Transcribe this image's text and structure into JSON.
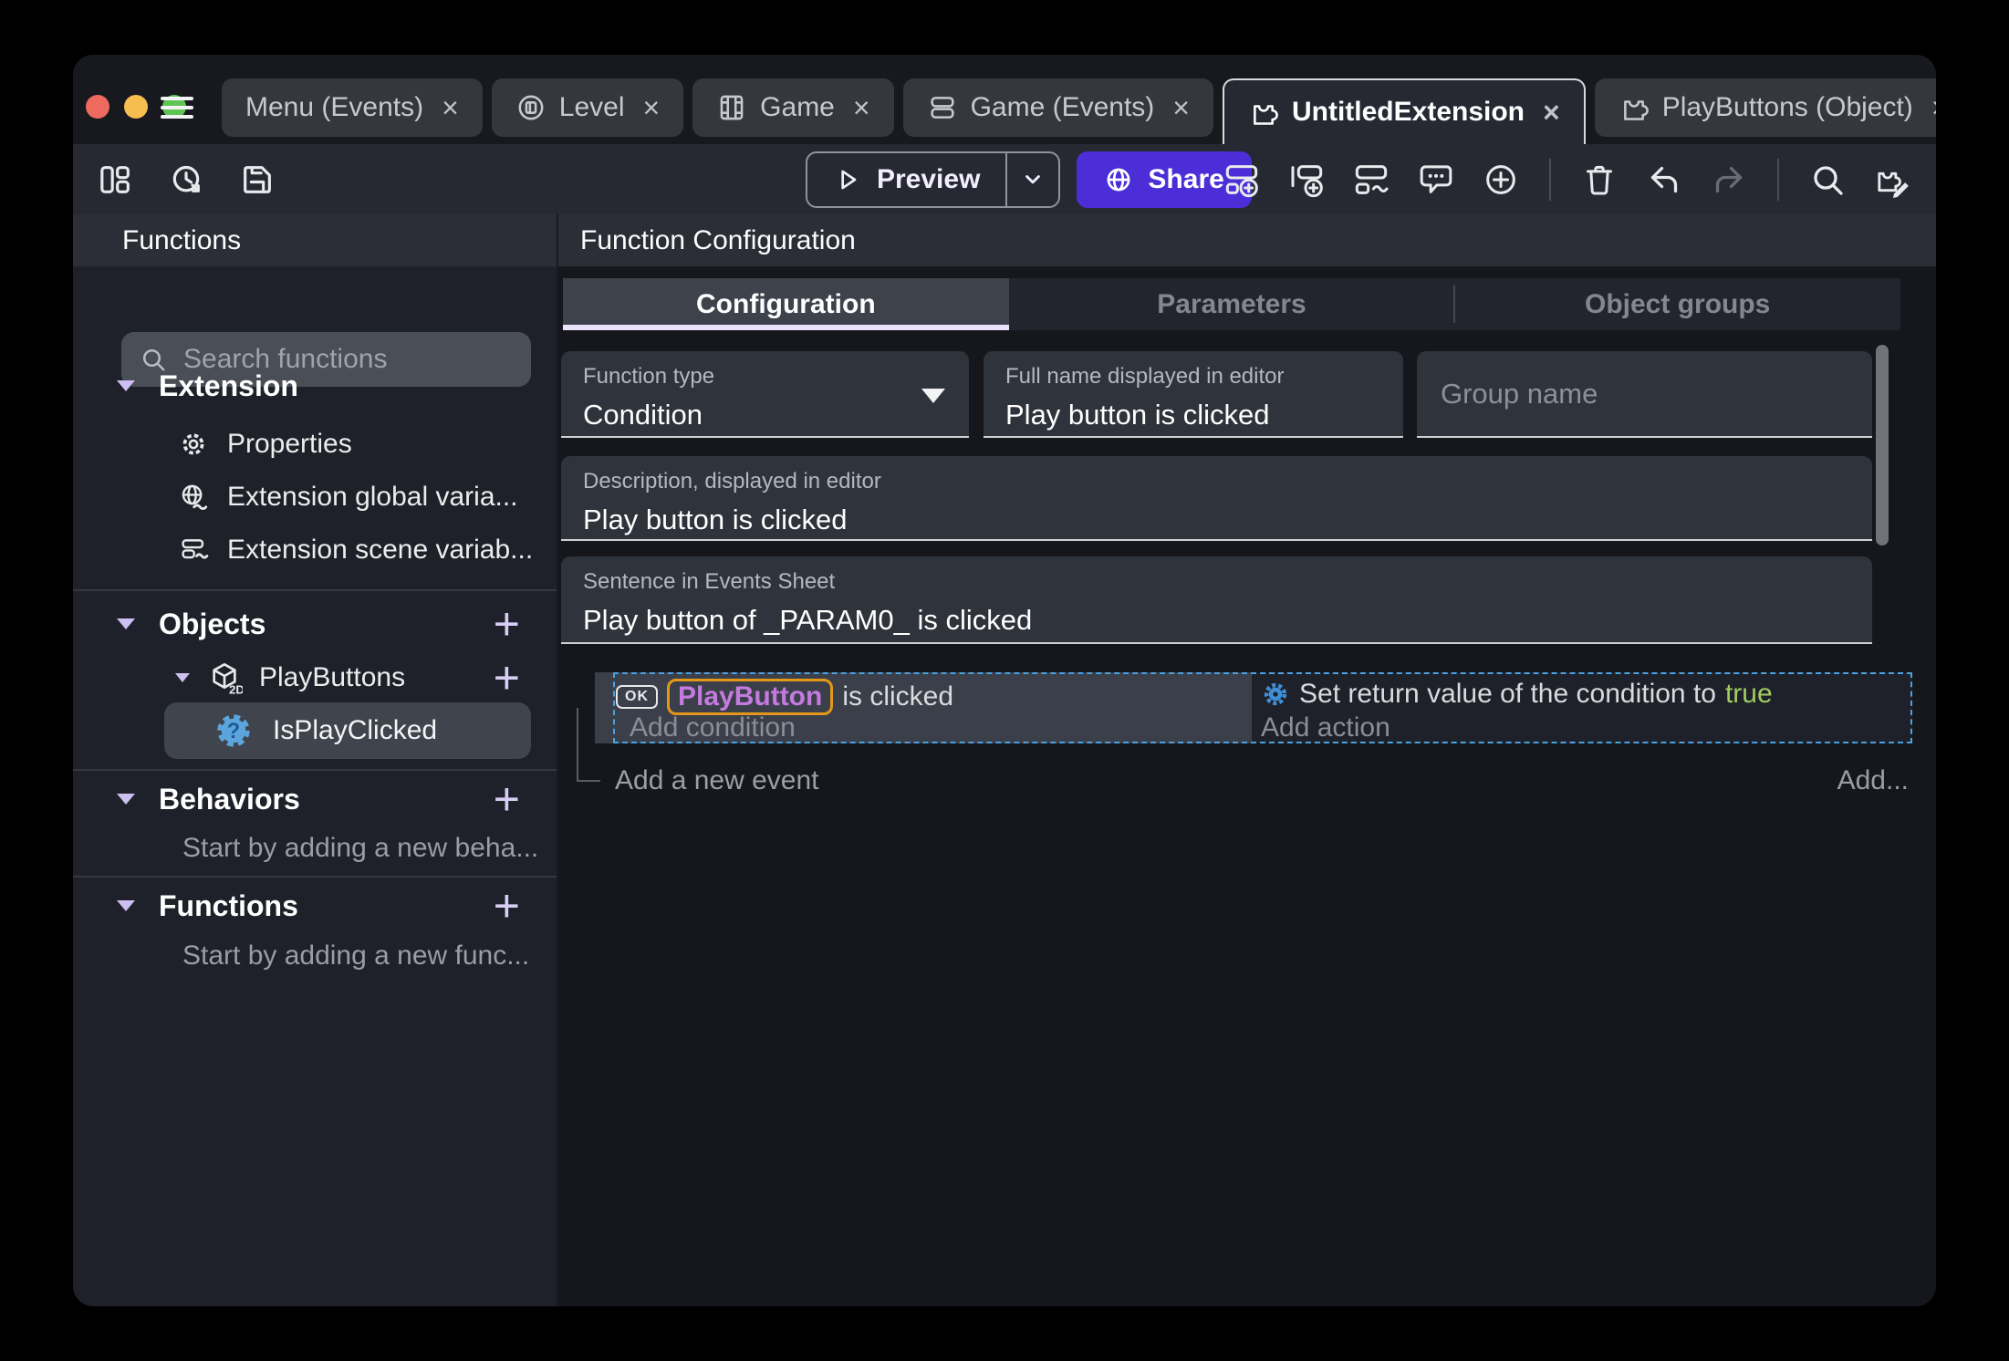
{
  "titlebar": {
    "close_glyph": "×",
    "tabs": [
      {
        "label": "Menu (Events)",
        "icon": null
      },
      {
        "label": "Level",
        "icon": "scene-icon"
      },
      {
        "label": "Game",
        "icon": "film-icon"
      },
      {
        "label": "Game (Events)",
        "icon": "events-sheet-icon"
      },
      {
        "label": "UntitledExtension",
        "icon": "extension-icon",
        "active": true
      },
      {
        "label": "PlayButtons (Object)",
        "icon": "extension-icon"
      }
    ]
  },
  "toolbar": {
    "preview_label": "Preview",
    "share_label": "Share",
    "icons_left": [
      "panels-icon",
      "history-icon",
      "save-icon"
    ],
    "icons_right": [
      "add-event-icon",
      "add-subevent-icon",
      "add-other-event-icon",
      "comment-icon",
      "circle-plus-icon",
      "trash-icon",
      "undo-icon",
      "redo-icon",
      "search-icon",
      "edit-extension-icon"
    ]
  },
  "sidebar": {
    "title": "Functions",
    "search_placeholder": "Search functions",
    "extension": {
      "label": "Extension",
      "items": [
        {
          "label": "Properties",
          "icon": "gear-icon"
        },
        {
          "label": "Extension global varia...",
          "icon": "globe-variable-icon"
        },
        {
          "label": "Extension scene variab...",
          "icon": "scene-variable-icon"
        }
      ]
    },
    "objects": {
      "label": "Objects",
      "object_label": "PlayButtons",
      "object_icon": "cube-2d-icon",
      "function_label": "IsPlayClicked",
      "function_icon": "condition-function-icon"
    },
    "behaviors": {
      "label": "Behaviors",
      "hint": "Start by adding a new beha..."
    },
    "functions": {
      "label": "Functions",
      "hint": "Start by adding a new func..."
    }
  },
  "main": {
    "title": "Function Configuration",
    "tabs": [
      {
        "label": "Configuration",
        "active": true
      },
      {
        "label": "Parameters"
      },
      {
        "label": "Object groups"
      }
    ],
    "fields": {
      "function_type": {
        "label": "Function type",
        "value": "Condition"
      },
      "full_name": {
        "label": "Full name displayed in editor",
        "value": "Play button is clicked"
      },
      "group_name": {
        "placeholder": "Group name",
        "value": ""
      },
      "description": {
        "label": "Description, displayed in editor",
        "value": "Play button is clicked"
      },
      "sentence": {
        "label": "Sentence in Events Sheet",
        "value": "Play button of _PARAM0_ is clicked"
      }
    },
    "events": {
      "condition": {
        "ok_badge": "OK",
        "object": "PlayButton",
        "suffix": "is clicked",
        "add_label": "Add condition"
      },
      "action": {
        "icon": "gear-blue-icon",
        "prefix": "Set return value of the condition to",
        "value": "true",
        "add_label": "Add action"
      },
      "add_event_label": "Add a new event",
      "add_more_label": "Add..."
    }
  },
  "colors": {
    "share_purple": "#4c2ed8",
    "selection_blue": "#4ba1e2",
    "object_text_violet": "#c47ade",
    "object_outline_orange": "#e2991a",
    "boolean_true_green": "#a0cd62",
    "traffic_red": "#ef6a5e",
    "traffic_yellow": "#f6be4f",
    "traffic_green": "#5fc454"
  }
}
